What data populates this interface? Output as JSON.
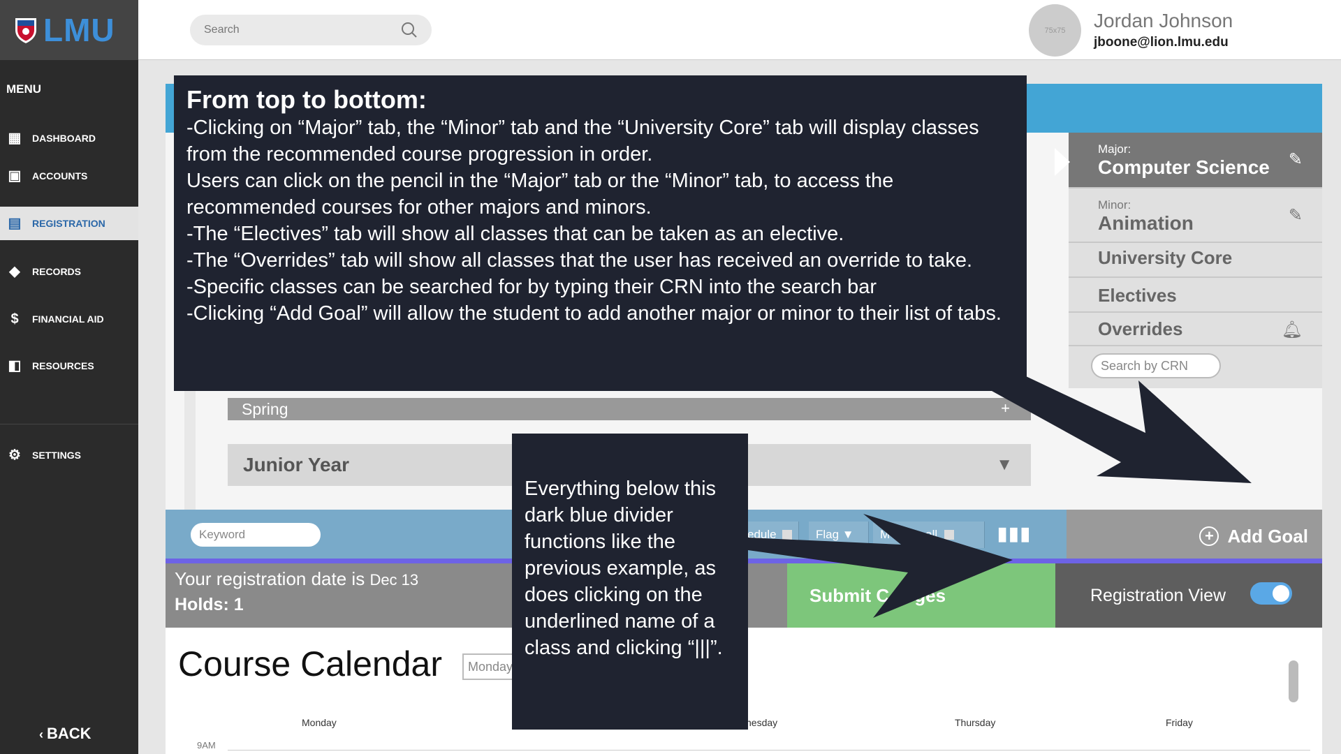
{
  "app": {
    "logo_text": "LMU"
  },
  "sidebar": {
    "menu_label": "MENU",
    "items": [
      {
        "label": "DASHBOARD",
        "icon": "dashboard-icon"
      },
      {
        "label": "ACCOUNTS",
        "icon": "accounts-icon"
      },
      {
        "label": "REGISTRATION",
        "icon": "calendar-icon",
        "active": true
      },
      {
        "label": "RECORDS",
        "icon": "graduation-cap-icon"
      },
      {
        "label": "FINANCIAL AID",
        "icon": "dollar-icon"
      },
      {
        "label": "RESOURCES",
        "icon": "resources-icon"
      },
      {
        "label": "SETTINGS",
        "icon": "gear-icon"
      }
    ],
    "back_label": "BACK"
  },
  "header": {
    "search_placeholder": "Search",
    "avatar_text": "75x75",
    "user_name": "Jordan Johnson",
    "user_email": "jboone@lion.lmu.edu"
  },
  "tabs": {
    "major_label": "Major:",
    "major_value": "Computer Science",
    "minor_label": "Minor:",
    "minor_value": "Animation",
    "core": "University Core",
    "electives": "Electives",
    "overrides": "Overrides",
    "crn_placeholder": "Search by CRN"
  },
  "plan": {
    "spring": "Spring",
    "plus": "+",
    "junior": "Junior Year"
  },
  "toolbar": {
    "keyword_placeholder": "Keyword",
    "schedule_partial": "edule",
    "flag": "Flag ▼",
    "remove_all_partial": "M      ve all",
    "bars": "▮▮▮",
    "add_goal": "Add Goal"
  },
  "status": {
    "reg_prefix": "Your registration date is ",
    "reg_date": "Dec 13",
    "holds": "Holds: 1",
    "submit": "Submit C     ges",
    "reg_view": "Registration View"
  },
  "calendar": {
    "title": "Course Calendar",
    "day_select": "Monday",
    "days": [
      "Monday",
      "nesday",
      "Thursday",
      "Friday"
    ],
    "time": "9AM"
  },
  "annotation1": {
    "heading": "From top to bottom:",
    "lines": [
      "-Clicking on “Major” tab, the “Minor” tab and the “University Core” tab will display classes from the recommended course progression in order.",
      "Users can click on the pencil in the “Major” tab or the “Minor” tab, to access the recommended courses for other majors and minors.",
      "-The “Electives” tab  will show all classes that can be taken as an elective.",
      "-The “Overrides” tab will show all classes that the user has received an override to take.",
      "-Specific classes can be searched for by typing their CRN into the search bar",
      "-Clicking “Add Goal” will allow the student to add another major or minor to their list of tabs."
    ]
  },
  "annotation2": {
    "text": "Everything below this dark blue divider functions like the previous example, as does clicking on the underlined name of a class and clicking “|||”."
  },
  "colors": {
    "sidebar": "#2b2b2b",
    "accent_blue": "#43a5d5",
    "submit_green": "#7dc67b",
    "divider_purple": "#6d63e6",
    "annotation_bg": "#1f2330"
  }
}
